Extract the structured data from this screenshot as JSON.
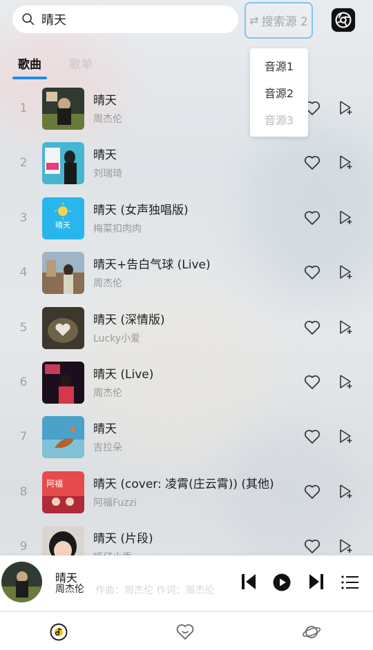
{
  "search": {
    "value": "晴天",
    "placeholder": ""
  },
  "source_button": {
    "label": "搜索源 2",
    "icon": "swap-icon"
  },
  "source_menu": [
    {
      "label": "音源1",
      "disabled": false
    },
    {
      "label": "音源2",
      "disabled": false
    },
    {
      "label": "音源3",
      "disabled": true
    }
  ],
  "tabs": [
    {
      "label": "歌曲",
      "active": true
    },
    {
      "label": "歌单",
      "active": false
    }
  ],
  "songs": [
    {
      "index": "1",
      "title": "晴天",
      "artist": "周杰伦"
    },
    {
      "index": "2",
      "title": "晴天",
      "artist": "刘瑞琦"
    },
    {
      "index": "3",
      "title": "晴天 (女声独唱版)",
      "artist": "梅菜扣肉肉"
    },
    {
      "index": "4",
      "title": "晴天+告白气球 (Live)",
      "artist": "周杰伦"
    },
    {
      "index": "5",
      "title": "晴天 (深情版)",
      "artist": "Lucky小爱"
    },
    {
      "index": "6",
      "title": "晴天 (Live)",
      "artist": "周杰伦"
    },
    {
      "index": "7",
      "title": "晴天",
      "artist": "吉拉朵"
    },
    {
      "index": "8",
      "title": "晴天 (cover: 凌霄(庄云霄)) (其他)",
      "artist": "阿福Fuzzi"
    },
    {
      "index": "9",
      "title": "晴天 (片段)",
      "artist": "呼仔小乖"
    }
  ],
  "player": {
    "title": "晴天",
    "artist": "周杰伦",
    "lyric": "作曲：周杰伦 作词：周杰伦"
  },
  "colors": {
    "accent": "#1f8ceb",
    "source_border": "#7fc3f0",
    "nav_active": "#f5c400"
  }
}
